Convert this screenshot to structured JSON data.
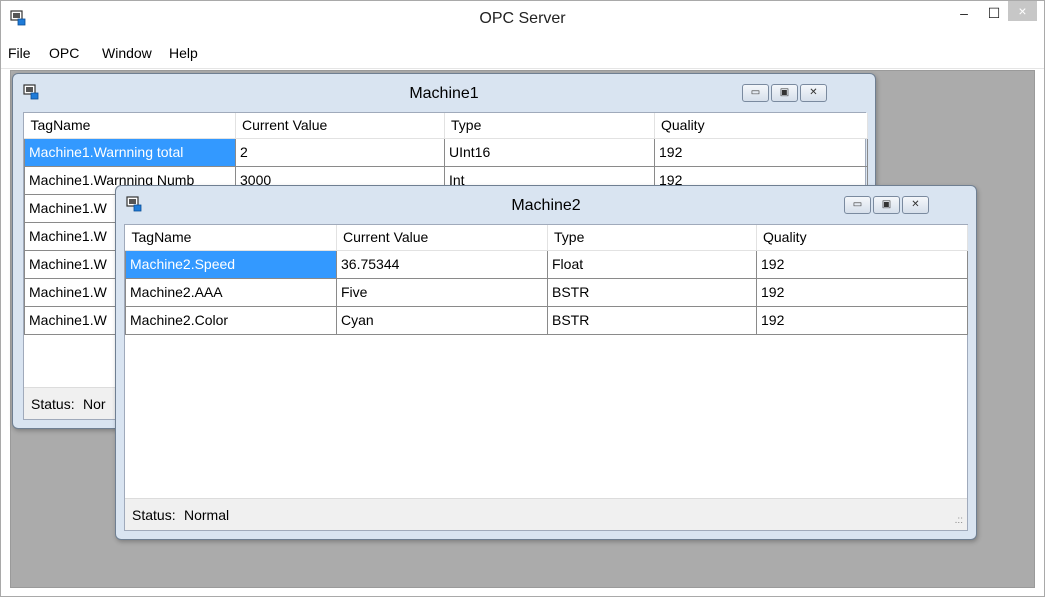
{
  "app": {
    "title": "OPC Server",
    "icon": "opc-server-app-icon",
    "controls": {
      "minimize": "–",
      "maximize": "☐",
      "close": "×"
    }
  },
  "menu": [
    "File",
    "OPC",
    "Window",
    "Help"
  ],
  "windows": {
    "machine1": {
      "title": "Machine1",
      "columns": [
        "TagName",
        "Current Value",
        "Type",
        "Quality"
      ],
      "rows": [
        [
          "Machine1.Warnning total",
          "2",
          "UInt16",
          "192"
        ],
        [
          "Machine1.Warnning Numb",
          "3000",
          "Int",
          "192"
        ],
        [
          "Machine1.W",
          "",
          "",
          ""
        ],
        [
          "Machine1.W",
          "",
          "",
          ""
        ],
        [
          "Machine1.W",
          "",
          "",
          ""
        ],
        [
          "Machine1.W",
          "",
          "",
          ""
        ],
        [
          "Machine1.W",
          "",
          "",
          ""
        ]
      ],
      "status_label": "Status:",
      "status_value": "Nor"
    },
    "machine2": {
      "title": "Machine2",
      "columns": [
        "TagName",
        "Current Value",
        "Type",
        "Quality"
      ],
      "rows": [
        [
          "Machine2.Speed",
          "36.75344",
          "Float",
          "192"
        ],
        [
          "Machine2.AAA",
          "Five",
          "BSTR",
          "192"
        ],
        [
          "Machine2.Color",
          "Cyan",
          "BSTR",
          "192"
        ]
      ],
      "status_label": "Status:",
      "status_value": "Normal"
    }
  },
  "colors": {
    "selection": "#3399ff",
    "mdi_background": "#ababab",
    "child_frame": "#d9e4f1"
  }
}
